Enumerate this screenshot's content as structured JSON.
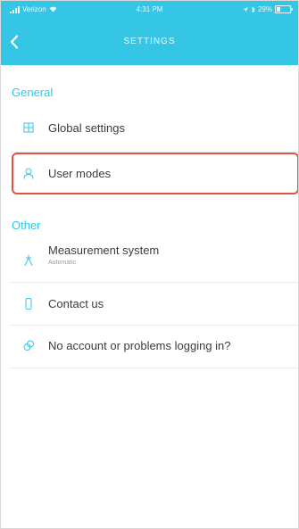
{
  "status_bar": {
    "carrier": "Verizon",
    "time": "4:31 PM",
    "battery_text": "29%",
    "battery_level": 0.29
  },
  "nav": {
    "title": "SETTINGS",
    "back_icon": "chevron-left-icon"
  },
  "sections": {
    "general": {
      "title": "General",
      "items": [
        {
          "label": "Global settings",
          "icon": "grid-icon"
        },
        {
          "label": "User modes",
          "icon": "user-icon",
          "highlighted": true
        }
      ]
    },
    "other": {
      "title": "Other",
      "items": [
        {
          "label": "Measurement system",
          "sublabel": "Automatic",
          "icon": "ruler-icon"
        },
        {
          "label": "Contact us",
          "icon": "phone-icon"
        },
        {
          "label": "No account or problems logging in?",
          "icon": "help-icon"
        }
      ]
    }
  },
  "colors": {
    "accent": "#35c6e6",
    "highlight_border": "#e0533f",
    "text": "#3b3b3b"
  }
}
